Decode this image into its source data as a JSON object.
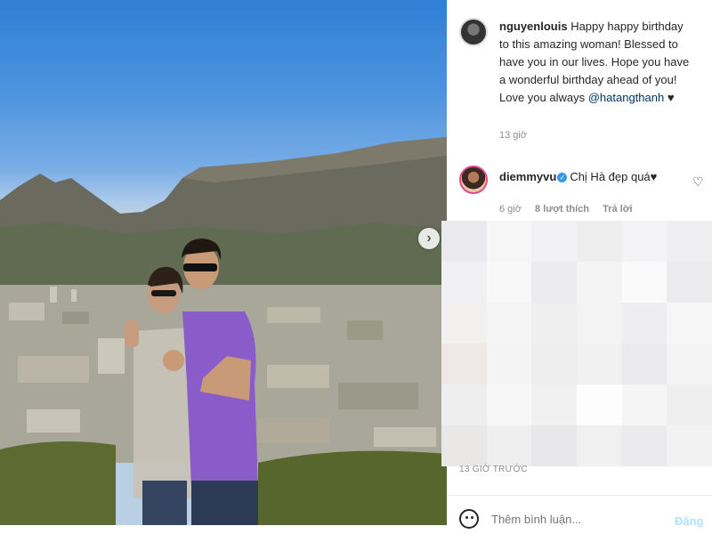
{
  "photo": {
    "next_icon": "chevron-right-icon"
  },
  "comments": [
    {
      "username": "nguyenlouis",
      "text": "Happy happy birthday to this amazing woman! Blessed to have you in our lives. Hope you have a wonderful birthday ahead of you! Love you always ",
      "mention": "@hatangthanh",
      "suffix": " ♥",
      "time": "13 giờ"
    },
    {
      "username": "diemmyvu",
      "verified": true,
      "text": "Chị Hà đẹp quá♥",
      "time": "6 giờ",
      "likes": "8 lượt thích",
      "reply": "Trả lời",
      "like_icon": "heart-outline-icon"
    }
  ],
  "post_time": "13 GIỜ TRƯỚC",
  "add_comment": {
    "placeholder": "Thêm bình luận...",
    "post_label": "Đăng",
    "emoji_icon": "emoji-smile-icon"
  },
  "colors": {
    "text": "#262626",
    "muted": "#8e8e8e",
    "link": "#00376b",
    "verified": "#3897f0",
    "post_disabled": "#b2dffc"
  }
}
